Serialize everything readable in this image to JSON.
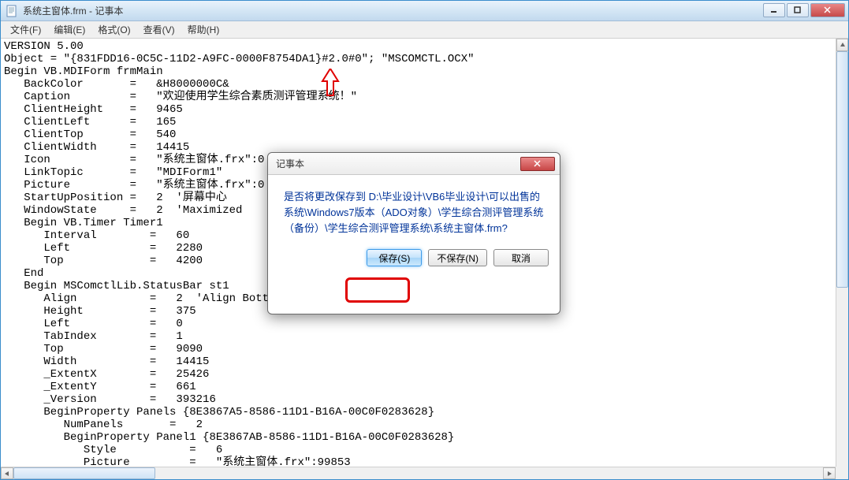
{
  "window": {
    "title": "系统主窗体.frm - 记事本"
  },
  "menu": {
    "items": [
      "文件(F)",
      "编辑(E)",
      "格式(O)",
      "查看(V)",
      "帮助(H)"
    ]
  },
  "text": "VERSION 5.00\nObject = \"{831FDD16-0C5C-11D2-A9FC-0000F8754DA1}#2.0#0\"; \"MSCOMCTL.OCX\"\nBegin VB.MDIForm frmMain \n   BackColor       =   &H8000000C&\n   Caption         =   \"欢迎使用学生综合素质测评管理系统！\"\n   ClientHeight    =   9465\n   ClientLeft      =   165\n   ClientTop       =   540\n   ClientWidth     =   14415\n   Icon            =   \"系统主窗体.frx\":0\n   LinkTopic       =   \"MDIForm1\"\n   Picture         =   \"系统主窗体.frx\":0\n   StartUpPosition =   2  '屏幕中心\n   WindowState     =   2  'Maximized\n   Begin VB.Timer Timer1 \n      Interval        =   60\n      Left            =   2280\n      Top             =   4200\n   End\n   Begin MSComctlLib.StatusBar st1 \n      Align           =   2  'Align Botto\n      Height          =   375\n      Left            =   0\n      TabIndex        =   1\n      Top             =   9090\n      Width           =   14415\n      _ExtentX        =   25426\n      _ExtentY        =   661\n      _Version        =   393216\n      BeginProperty Panels {8E3867A5-8586-11D1-B16A-00C0F0283628} \n         NumPanels       =   2\n         BeginProperty Panel1 {8E3867AB-8586-11D1-B16A-00C0F0283628} \n            Style           =   6\n            Picture         =   \"系统主窗体.frx\":99853",
  "dialog": {
    "title": "记事本",
    "message": "是否将更改保存到 D:\\毕业设计\\VB6毕业设计\\可以出售的系统\\Windows7版本（ADO对象）\\学生综合测评管理系统（备份）\\学生综合测评管理系统\\系统主窗体.frm?",
    "buttons": {
      "save": "保存(S)",
      "dontsave": "不保存(N)",
      "cancel": "取消"
    }
  }
}
